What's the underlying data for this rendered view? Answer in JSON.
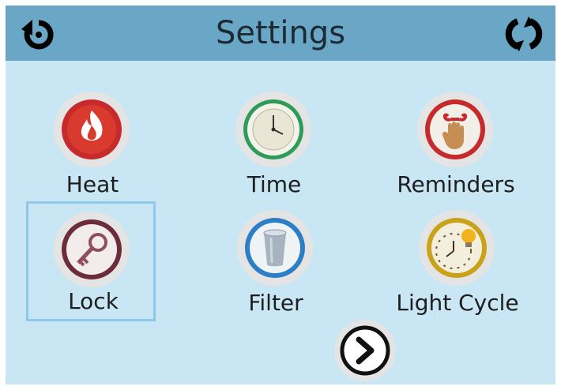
{
  "header": {
    "title": "Settings",
    "back_icon": "back-arrow-icon",
    "refresh_icon": "refresh-icon"
  },
  "tiles": [
    {
      "label": "Heat",
      "icon": "flame-icon",
      "color": "#c62a2a"
    },
    {
      "label": "Time",
      "icon": "clock-icon",
      "color": "#2e9b57"
    },
    {
      "label": "Reminders",
      "icon": "reminder-hand-icon",
      "color": "#c62a2a"
    },
    {
      "label": "Lock",
      "icon": "key-icon",
      "color": "#6d2c3a",
      "selected": true
    },
    {
      "label": "Filter",
      "icon": "filter-icon",
      "color": "#2c7fc4"
    },
    {
      "label": "Light Cycle",
      "icon": "light-cycle-icon",
      "color": "#c9a21a"
    }
  ],
  "next_icon": "chevron-right-icon",
  "colors": {
    "background": "#c8e6f4",
    "header": "#6aa6c6",
    "selection_border": "#8ec8ea"
  }
}
